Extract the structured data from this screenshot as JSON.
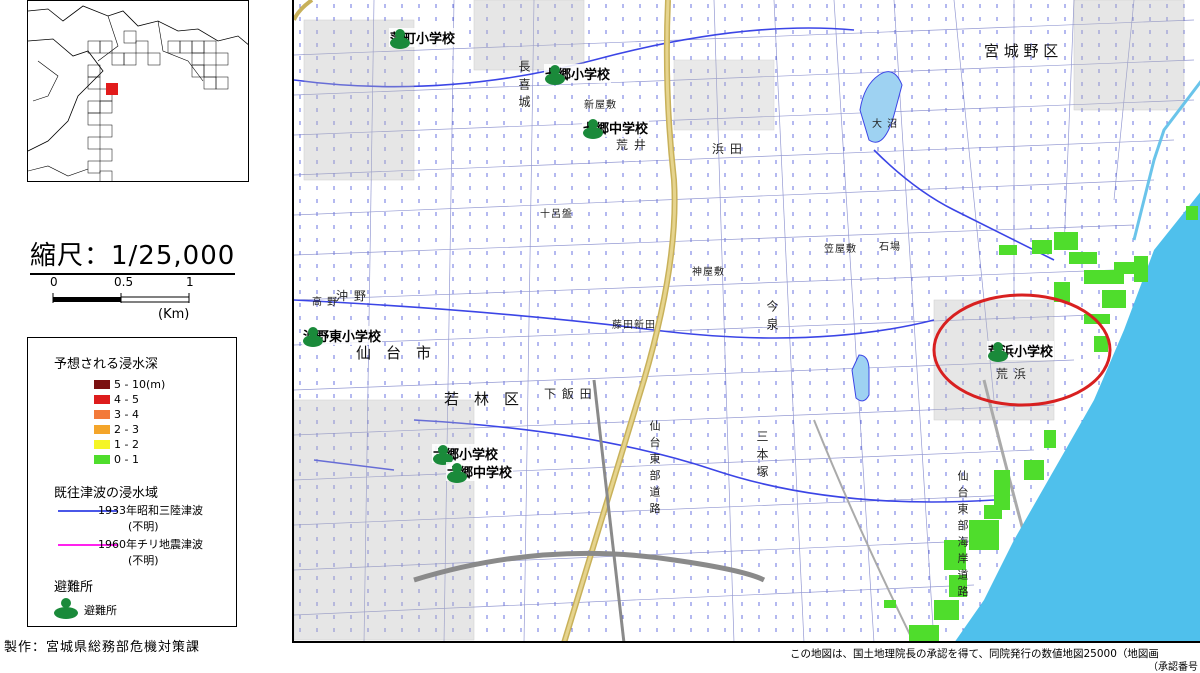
{
  "scale": {
    "title": "縮尺：1/25,000",
    "ticks": [
      "0",
      "0.5",
      "1"
    ],
    "unit": "(Km)"
  },
  "legend": {
    "depth_title": "予想される浸水深",
    "depth_items": [
      {
        "label": "5 - 10(m)",
        "color": "#7b1010"
      },
      {
        "label": "4 - 5",
        "color": "#dd1c1c"
      },
      {
        "label": "3 - 4",
        "color": "#f37a3a"
      },
      {
        "label": "2 - 3",
        "color": "#f4a52a"
      },
      {
        "label": "1 - 2",
        "color": "#f5f526"
      },
      {
        "label": "0 - 1",
        "color": "#4fdd2c"
      }
    ],
    "tsunami_title": "既往津波の浸水域",
    "tsunami_items": [
      {
        "label": "1933年昭和三陸津波",
        "sub": "(不明)",
        "color": "#4a57e8"
      },
      {
        "label": "1960年チリ地震津波",
        "sub": "(不明)",
        "color": "#ff22ee"
      }
    ],
    "shelter_title": "避難所",
    "shelter_label": "避難所"
  },
  "credit": "製作：宮城県総務部危機対策課",
  "schools": [
    {
      "name": "蒲町小学校"
    },
    {
      "name": "七郷小学校"
    },
    {
      "name": "七郷中学校"
    },
    {
      "name": "沖野東小学校"
    },
    {
      "name": "六郷小学校"
    },
    {
      "name": "六郷中学校"
    },
    {
      "name": "荒浜小学校"
    }
  ],
  "places": {
    "city": "仙　台　市",
    "ward_wakabayashi": "若　林　区",
    "ward_miyagino": "宮 城 野 区",
    "shimoiida": "下 飯 田",
    "oonuma": "大 沼",
    "arahama": "荒 浜",
    "arai": "荒 井",
    "fukuda": "浜 田",
    "kasayashiki": "笠屋敷",
    "ishiba": "石場",
    "kamiyashiki": "神屋敷",
    "fujita": "藤田新田",
    "juugohai": "十呂盤",
    "sanbonzuka": "三 本 塚",
    "okino": "沖 野",
    "takano": "高 野",
    "nanamengo": "長 喜 城",
    "shinyashiki": "新屋敷",
    "imaizumi": "今 泉",
    "road_east": "仙 台 東 部 道 路",
    "road_coast": "仙 台 東 部 海 岸 道 路"
  },
  "footnote": "この地図は、国土地理院長の承認を得て、同院発行の数値地図25000（地図画",
  "footnote2": "（承認番号"
}
